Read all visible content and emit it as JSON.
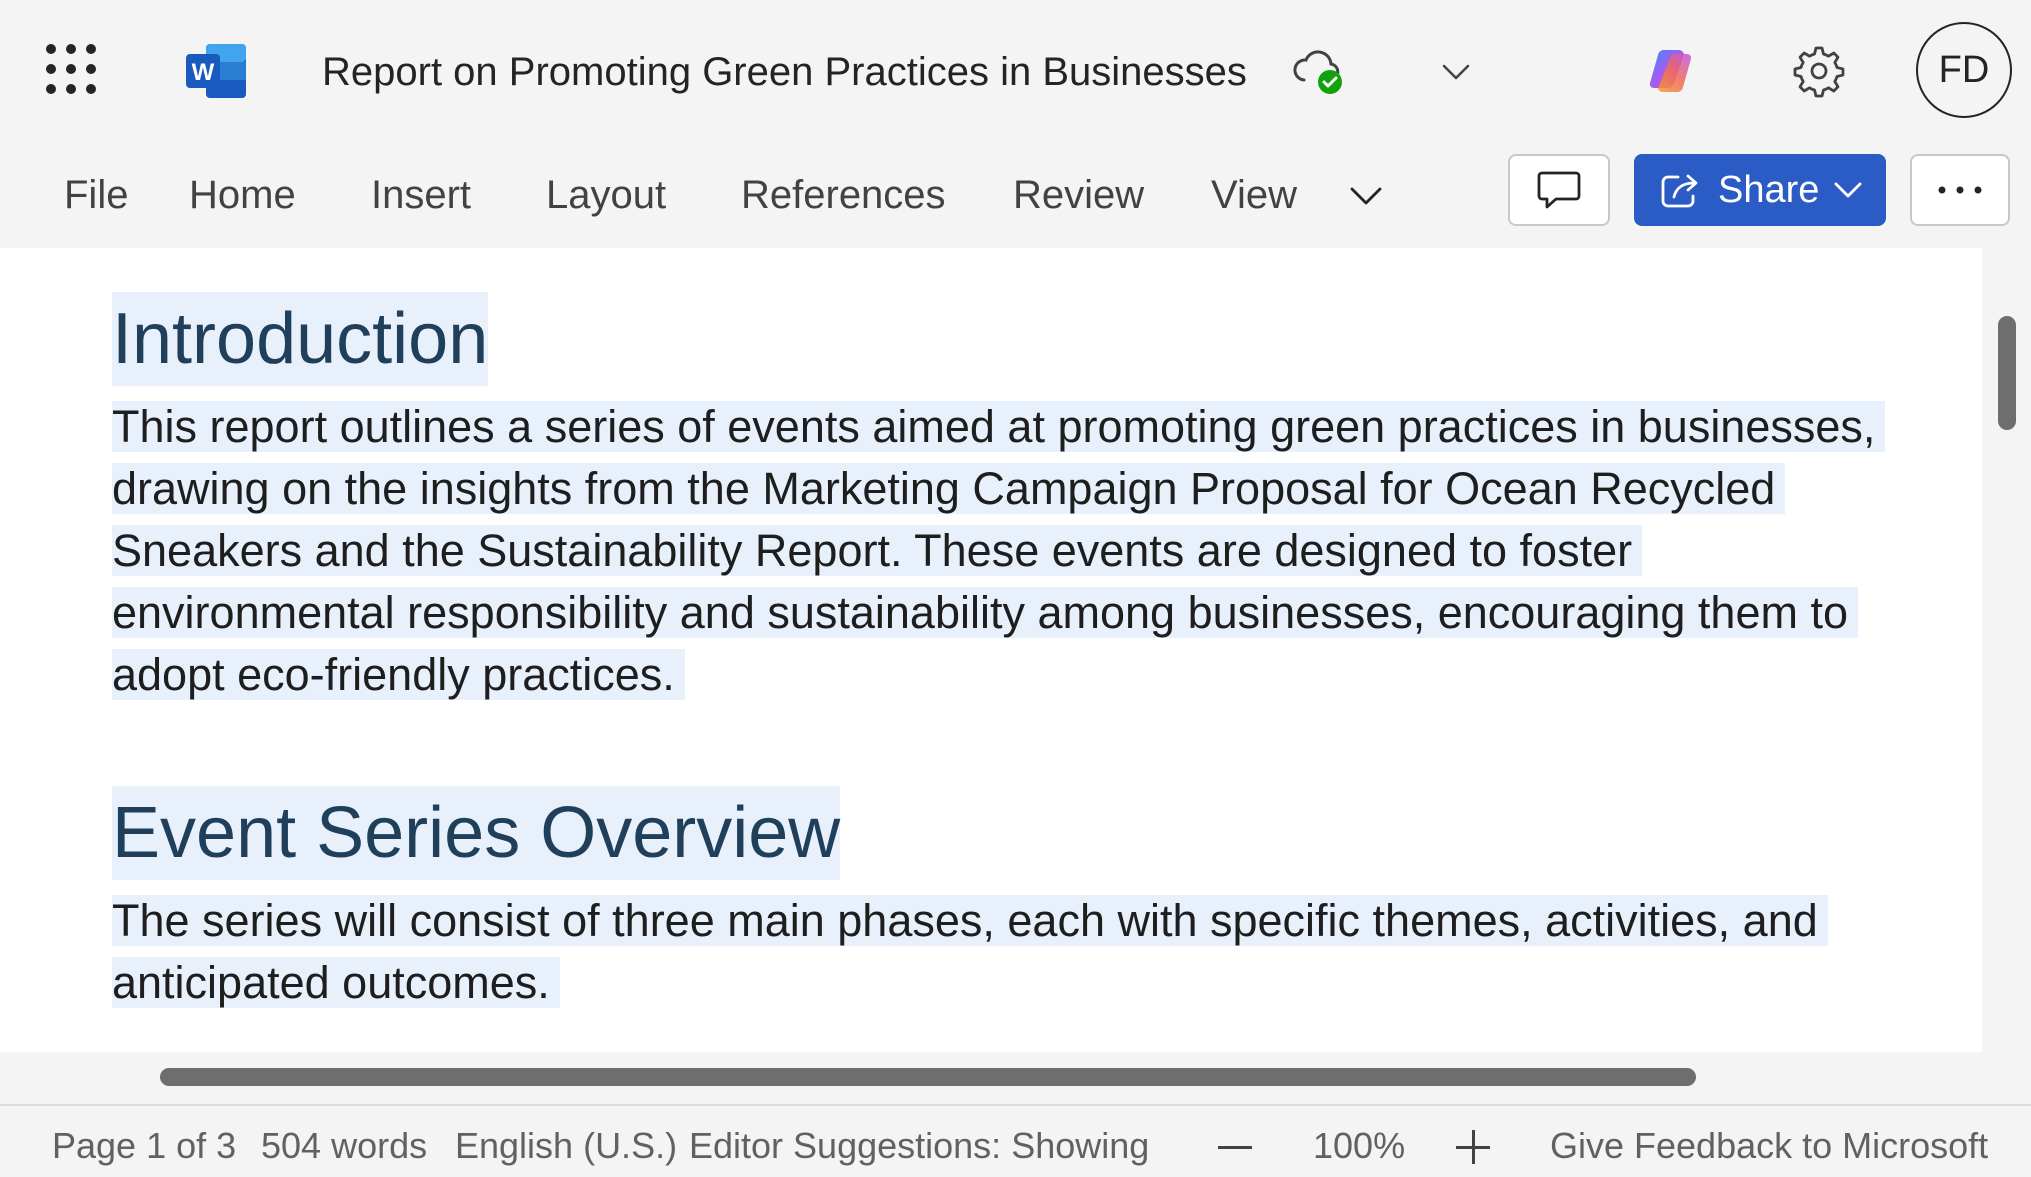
{
  "app": {
    "doc_title": "Report on Promoting Green Practices in Businesses",
    "avatar_initials": "FD",
    "logo_letter": "W",
    "icons": {
      "app_launcher": "waffle-grid-icon",
      "cloud_saved": "cloud-check-icon",
      "copilot": "copilot-icon",
      "settings": "gear-icon"
    }
  },
  "ribbon": {
    "tabs": [
      "File",
      "Home",
      "Insert",
      "Layout",
      "References",
      "Review",
      "View"
    ],
    "share_label": "Share",
    "colors": {
      "share_bg": "#2b5cc5"
    }
  },
  "document": {
    "sections": [
      {
        "heading": "Introduction",
        "paragraph": "This report outlines a series of events aimed at promoting green practices in businesses, drawing on the insights from the Marketing Campaign Proposal for Ocean Recycled Sneakers and the Sustainability Report. These events are designed to foster environmental responsibility and sustainability among businesses, encouraging them to adopt eco-friendly practices."
      },
      {
        "heading": "Event Series Overview",
        "paragraph": "The series will consist of three main phases, each with specific themes, activities, and anticipated outcomes."
      }
    ],
    "colors": {
      "heading": "#1f3f5a",
      "selection": "#e8f0fb"
    }
  },
  "status": {
    "page": "Page 1 of 3",
    "words": "504 words",
    "language": "English (U.S.)",
    "editor": "Editor Suggestions: Showing",
    "zoom": "100%",
    "feedback": "Give Feedback to Microsoft"
  }
}
